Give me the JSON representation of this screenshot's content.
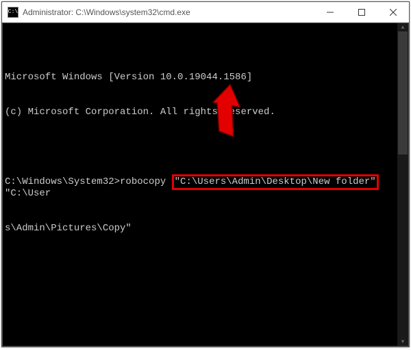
{
  "titlebar": {
    "icon_label": "C:\\",
    "title": "Administrator: C:\\Windows\\system32\\cmd.exe"
  },
  "terminal": {
    "line1": "Microsoft Windows [Version 10.0.19044.1586]",
    "line2": "(c) Microsoft Corporation. All rights reserved.",
    "prompt": "C:\\Windows\\System32>",
    "command": "robocopy ",
    "highlighted": "\"C:\\Users\\Admin\\Desktop\\New folder\"",
    "after_highlight": " \"C:\\User",
    "continuation": "s\\Admin\\Pictures\\Copy\""
  },
  "annotation": {
    "arrow_color": "#e30000"
  }
}
